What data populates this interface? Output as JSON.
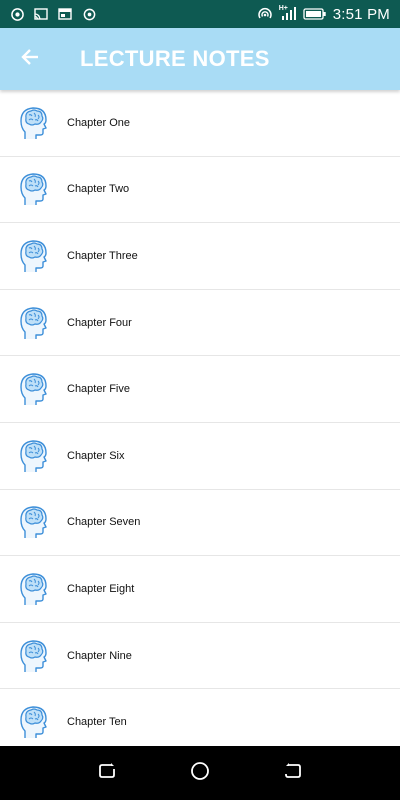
{
  "status_bar": {
    "time": "3:51 PM",
    "icons": [
      "chrome-icon",
      "cast-icon",
      "news-icon",
      "record-icon",
      "hotspot-icon",
      "signal-icon",
      "battery-icon"
    ],
    "network_label": "H+"
  },
  "app_bar": {
    "title": "LECTURE NOTES",
    "back_icon": "arrow-left-icon",
    "background": "#a9dcf5"
  },
  "chapters": [
    {
      "label": "Chapter One",
      "icon": "brain-head-icon"
    },
    {
      "label": "Chapter Two",
      "icon": "brain-head-icon"
    },
    {
      "label": "Chapter Three",
      "icon": "brain-head-icon"
    },
    {
      "label": "Chapter Four",
      "icon": "brain-head-icon"
    },
    {
      "label": "Chapter Five",
      "icon": "brain-head-icon"
    },
    {
      "label": "Chapter Six",
      "icon": "brain-head-icon"
    },
    {
      "label": "Chapter Seven",
      "icon": "brain-head-icon"
    },
    {
      "label": "Chapter Eight",
      "icon": "brain-head-icon"
    },
    {
      "label": "Chapter Nine",
      "icon": "brain-head-icon"
    },
    {
      "label": "Chapter Ten",
      "icon": "brain-head-icon"
    }
  ],
  "nav_bar": {
    "buttons": [
      "recents-icon",
      "home-icon",
      "back-nav-icon"
    ]
  },
  "colors": {
    "status_bar": "#0e5a52",
    "app_bar": "#a9dcf5",
    "icon_accent": "#3d8fd9"
  }
}
